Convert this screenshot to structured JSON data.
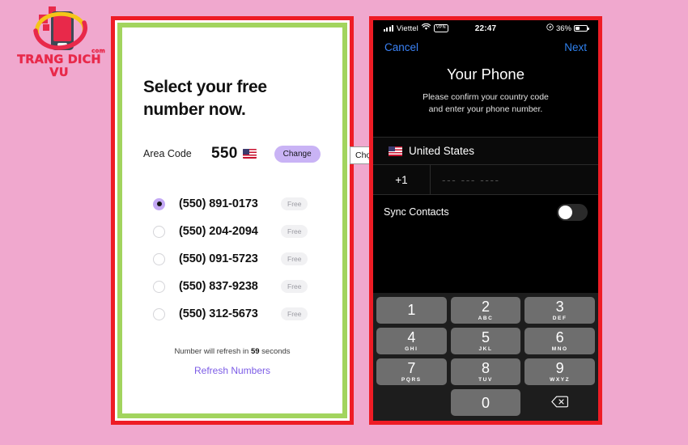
{
  "logo": {
    "brand": "TRANG DICH VU",
    "suffix": "com"
  },
  "left_panel": {
    "headline": "Select your free number now.",
    "area_code": {
      "label": "Area Code",
      "value": "550",
      "flag_icon": "us-flag-icon",
      "change_label": "Change"
    },
    "tooltip": "Chọn Se",
    "numbers": [
      {
        "number": "(550) 891-0173",
        "badge": "Free",
        "selected": true
      },
      {
        "number": "(550) 204-2094",
        "badge": "Free",
        "selected": false
      },
      {
        "number": "(550) 091-5723",
        "badge": "Free",
        "selected": false
      },
      {
        "number": "(550) 837-9238",
        "badge": "Free",
        "selected": false
      },
      {
        "number": "(550) 312-5673",
        "badge": "Free",
        "selected": false
      }
    ],
    "refresh_prefix": "Number will refresh in ",
    "refresh_seconds": "59",
    "refresh_suffix": " seconds",
    "refresh_link": "Refresh Numbers",
    "accent_color": "#7C5CE6",
    "border_outer_color": "#EE1C25",
    "border_inner_color": "#A2D45E"
  },
  "right_panel": {
    "statusbar": {
      "carrier": "Viettel",
      "signal_icon": "signal-bars-icon",
      "wifi_icon": "wifi-icon",
      "vpn_label": "VPN",
      "time": "22:47",
      "location_icon": "location-arrow-icon",
      "battery_percent": "36%"
    },
    "navbar": {
      "cancel": "Cancel",
      "next": "Next"
    },
    "title": "Your Phone",
    "subtitle_line1": "Please confirm your country code",
    "subtitle_line2": "and enter your phone number.",
    "country": {
      "flag_icon": "us-flag-icon",
      "name": "United States"
    },
    "phone_input": {
      "country_code": "+1",
      "placeholder": "--- --- ----"
    },
    "sync_contacts": {
      "label": "Sync Contacts",
      "enabled": false
    },
    "keypad": [
      [
        {
          "digit": "1",
          "letters": ""
        },
        {
          "digit": "2",
          "letters": "ABC"
        },
        {
          "digit": "3",
          "letters": "DEF"
        }
      ],
      [
        {
          "digit": "4",
          "letters": "GHI"
        },
        {
          "digit": "5",
          "letters": "JKL"
        },
        {
          "digit": "6",
          "letters": "MNO"
        }
      ],
      [
        {
          "digit": "7",
          "letters": "PQRS"
        },
        {
          "digit": "8",
          "letters": "TUV"
        },
        {
          "digit": "9",
          "letters": "WXYZ"
        }
      ]
    ],
    "keypad_zero": {
      "digit": "0",
      "letters": ""
    },
    "delete_icon": "backspace-icon",
    "border_color": "#EE1C25"
  },
  "background_color": "#F0A8CE"
}
